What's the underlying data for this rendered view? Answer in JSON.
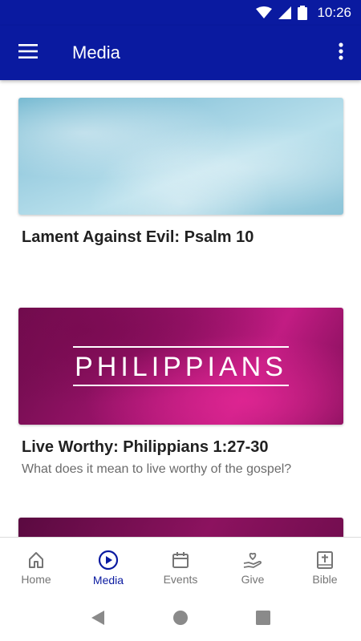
{
  "status_bar": {
    "time": "10:26"
  },
  "app_bar": {
    "title": "Media"
  },
  "media_items": [
    {
      "title": "Lament Against Evil: Psalm 10",
      "subtitle": ""
    },
    {
      "title": "Live Worthy: Philippians 1:27-30",
      "subtitle": "What does it mean to live worthy of the gospel?",
      "image_text": "PHILIPPIANS"
    }
  ],
  "bottom_nav": {
    "items": [
      {
        "label": "Home",
        "icon": "home-icon",
        "active": false
      },
      {
        "label": "Media",
        "icon": "play-circle-icon",
        "active": true
      },
      {
        "label": "Events",
        "icon": "calendar-icon",
        "active": false
      },
      {
        "label": "Give",
        "icon": "give-hand-heart-icon",
        "active": false
      },
      {
        "label": "Bible",
        "icon": "bible-icon",
        "active": false
      }
    ]
  },
  "colors": {
    "primary": "#0a1aa0",
    "inactive": "#757575"
  }
}
